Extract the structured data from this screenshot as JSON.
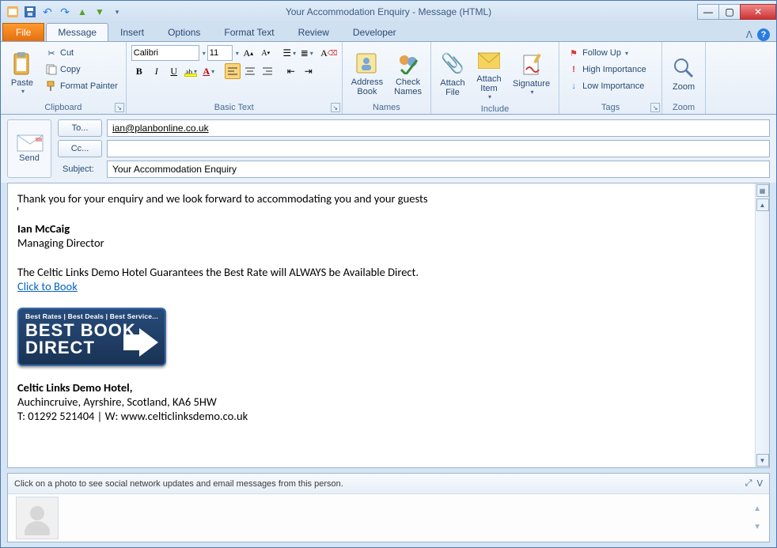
{
  "window": {
    "title": "Your Accommodation Enquiry  -  Message (HTML)"
  },
  "qat_icons": [
    "outlook-icon",
    "save-icon",
    "undo-icon",
    "redo-icon",
    "prev-icon",
    "next-icon",
    "more-icon"
  ],
  "tabs": {
    "file": "File",
    "items": [
      "Message",
      "Insert",
      "Options",
      "Format Text",
      "Review",
      "Developer"
    ],
    "active": 0
  },
  "ribbon": {
    "clipboard": {
      "paste": "Paste",
      "cut": "Cut",
      "copy": "Copy",
      "format_painter": "Format Painter",
      "label": "Clipboard"
    },
    "basic_text": {
      "font_name": "Calibri",
      "font_size": "11",
      "label": "Basic Text"
    },
    "names": {
      "address_book": "Address\nBook",
      "check_names": "Check\nNames",
      "label": "Names"
    },
    "include": {
      "attach_file": "Attach\nFile",
      "attach_item": "Attach\nItem",
      "signature": "Signature",
      "label": "Include"
    },
    "tags": {
      "follow_up": "Follow Up",
      "high": "High Importance",
      "low": "Low Importance",
      "label": "Tags"
    },
    "zoom": {
      "zoom": "Zoom",
      "label": "Zoom"
    }
  },
  "header": {
    "send": "Send",
    "to_btn": "To...",
    "cc_btn": "Cc...",
    "subject_label": "Subject:",
    "to_value": "ian@planbonline.co.uk",
    "cc_value": "",
    "subject_value": "Your Accommodation Enquiry"
  },
  "body": {
    "line1": "Thank you for your enquiry and we look forward to accommodating you and your guests",
    "name": "Ian McCaig",
    "role": "Managing Director",
    "guarantee": "The Celtic Links Demo Hotel Guarantees the Best Rate will ALWAYS be Available Direct.",
    "book_link": "Click to Book",
    "logo_top": "Best Rates | Best Deals | Best Service...",
    "logo_line1": "BEST BOOK",
    "logo_line2": "DIRECT",
    "hotel": "Celtic Links Demo Hotel,",
    "address": "Auchincruive, Ayrshire, Scotland, KA6 5HW",
    "contact": "T: 01292 521404 | W: www.celticlinksdemo.co.uk"
  },
  "people_pane": {
    "hint": "Click on a photo to see social network updates and email messages from this person."
  }
}
